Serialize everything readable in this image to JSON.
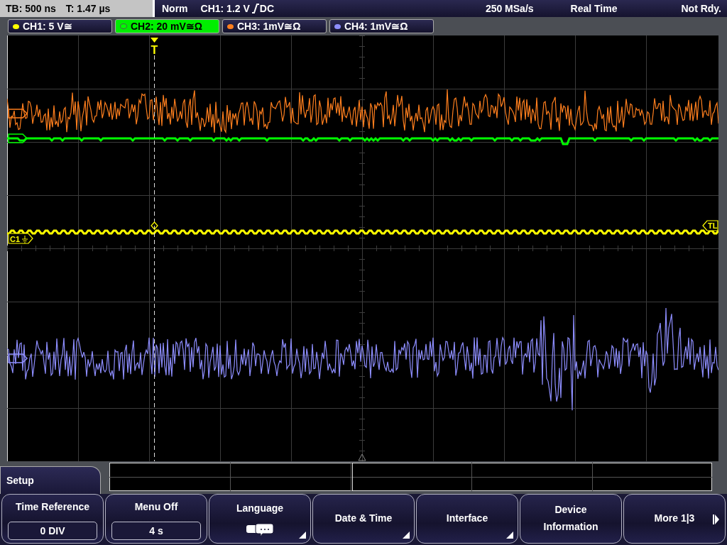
{
  "status_bar": {
    "timebase": "TB: 500 ns",
    "trigger_time": "T: 1.47 µs",
    "mode": "Norm",
    "trigger_level": "CH1: 1.2 V",
    "trigger_coupling": "DC",
    "sample_rate": "250 MSa/s",
    "acquisition": "Real Time",
    "state": "Not Rdy."
  },
  "channels": [
    {
      "label": "CH1: 5 V≅",
      "selected": false,
      "color": "#ffff00"
    },
    {
      "label": "CH2: 20 mV≅Ω",
      "selected": true,
      "color": "#00ff00"
    },
    {
      "label": "CH3: 1mV≅Ω",
      "selected": false,
      "color": "#ff7f1e"
    },
    {
      "label": "CH4: 1mV≅Ω",
      "selected": false,
      "color": "#8e8eff"
    }
  ],
  "plot": {
    "trigger_marker": "T",
    "channel_marker": "C1",
    "level_marker": "TL"
  },
  "menu": {
    "title": "Setup"
  },
  "softkeys": [
    {
      "kind": "value",
      "label": "Time Reference",
      "value": "0 DIV",
      "submenu": false
    },
    {
      "kind": "value",
      "label": "Menu Off",
      "value": "4 s",
      "submenu": false
    },
    {
      "kind": "icon",
      "label": "Language",
      "submenu": true
    },
    {
      "kind": "label",
      "label": "Date & Time",
      "submenu": true
    },
    {
      "kind": "label",
      "label": "Interface",
      "submenu": true
    },
    {
      "kind": "label",
      "label": "Device Information",
      "submenu": false
    },
    {
      "kind": "more",
      "label": "More 1|3",
      "submenu": false
    }
  ]
}
